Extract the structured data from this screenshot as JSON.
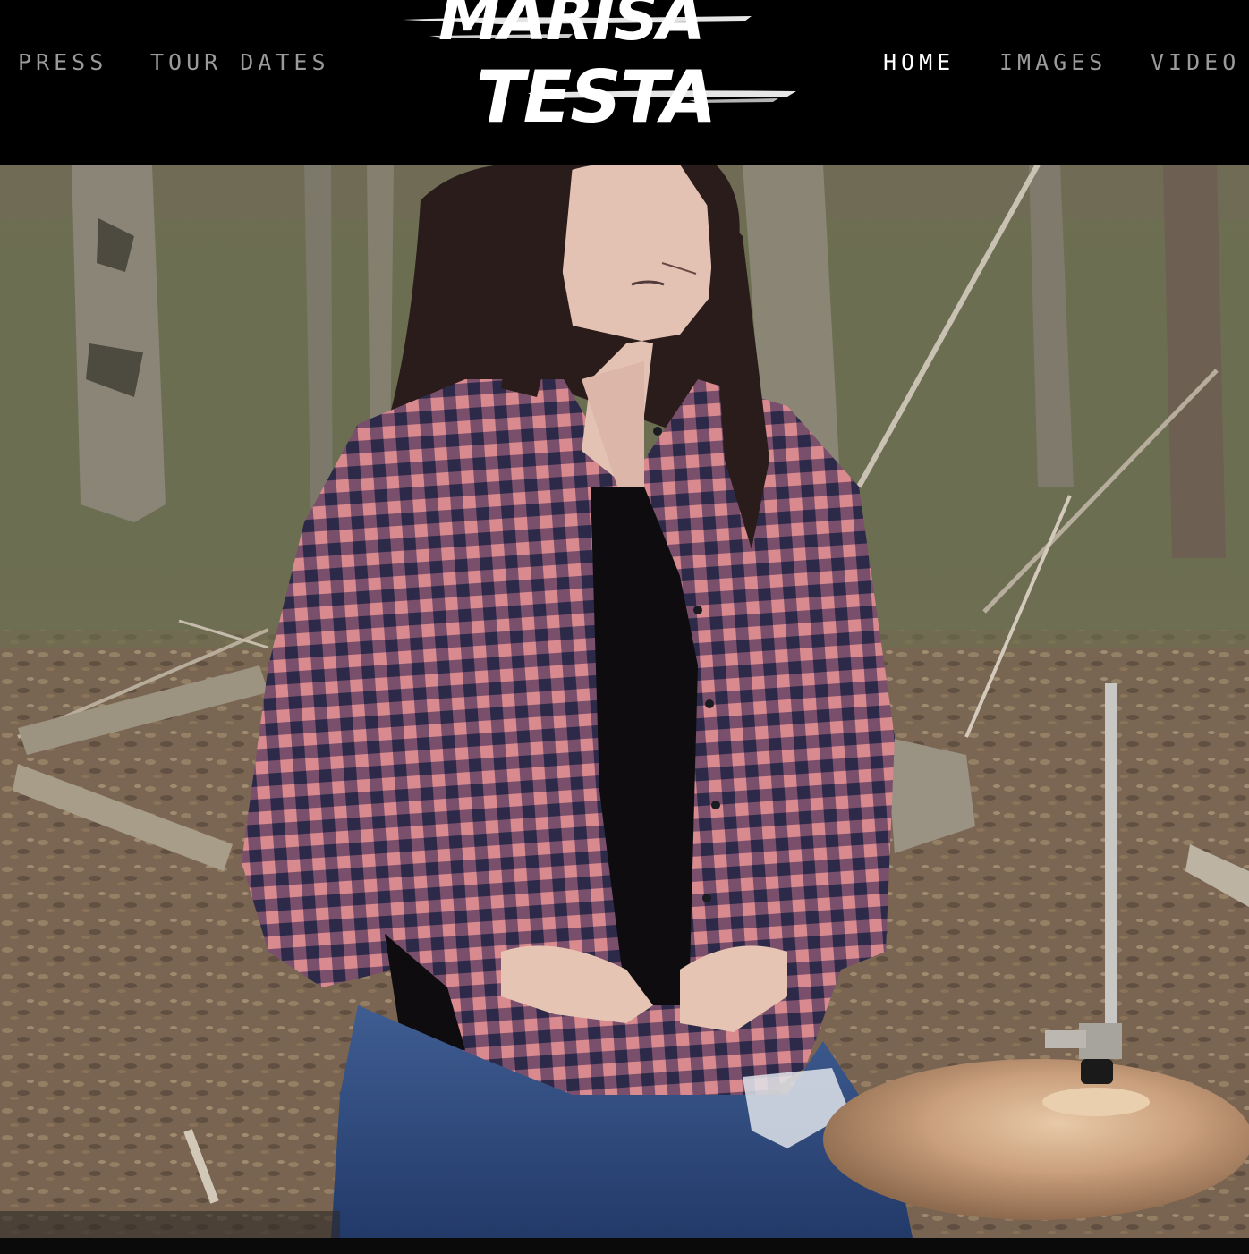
{
  "nav": {
    "left": [
      {
        "label": "PRESS",
        "active": false
      },
      {
        "label": "TOUR DATES",
        "active": false
      }
    ],
    "right": [
      {
        "label": "HOME",
        "active": true
      },
      {
        "label": "IMAGES",
        "active": false
      },
      {
        "label": "VIDEO",
        "active": false
      }
    ]
  },
  "logo": {
    "line1": "MARISA",
    "line2": "TESTA"
  },
  "hero": {
    "subject": "hero-photo"
  },
  "colors": {
    "background": "#000000",
    "nav_inactive": "#9a9a9a",
    "nav_active": "#ffffff"
  }
}
